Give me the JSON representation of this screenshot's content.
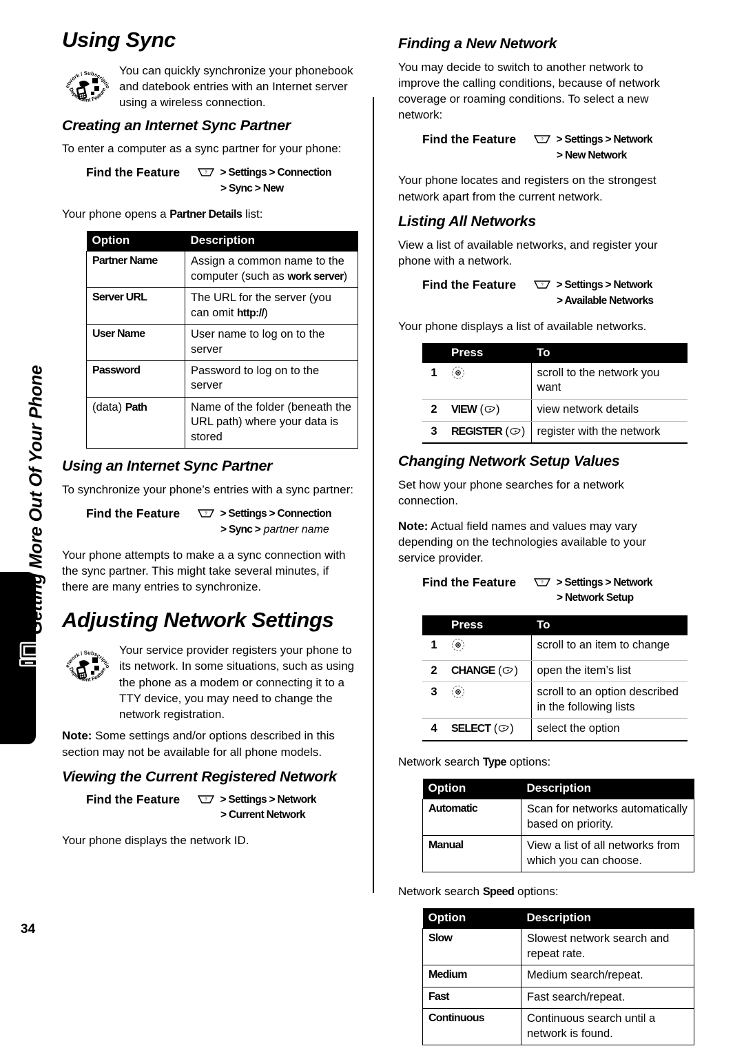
{
  "page": {
    "number": "34",
    "sidebar_title": "Getting More Out Of Your Phone",
    "sidebar_tab_icon": "computer-phone-icon"
  },
  "icons": {
    "menu_key": "menu-key-icon",
    "nav_key": "navigation-key-icon",
    "soft_key": "soft-key-icon",
    "feature_badge_top": "Network / Subscription",
    "feature_badge_bottom": "Dependent Feature"
  },
  "left": {
    "title": "Using Sync",
    "intro": "You can quickly synchronize your phonebook and datebook entries with an Internet server using a wireless connection.",
    "creating": {
      "heading": "Creating an Internet Sync Partner",
      "lead": "To enter a computer as a sync partner for your phone:",
      "fft_label": "Find the Feature",
      "fft_line1": "> Settings > Connection",
      "fft_line2": "> Sync > New",
      "after_pre": "Your phone opens a ",
      "after_bold": "Partner Details",
      "after_post": " list:",
      "table": {
        "headers": [
          "Option",
          "Description"
        ],
        "rows": [
          {
            "option": "Partner Name",
            "desc_pre": "Assign a common name to the computer (such as ",
            "desc_bold": "work server",
            "desc_post": ")"
          },
          {
            "option": "Server URL",
            "desc_pre": "The URL for the server (you can omit ",
            "desc_bold": "http://",
            "desc_post": ")"
          },
          {
            "option": "User Name",
            "desc_pre": "User name to log on to the server",
            "desc_bold": "",
            "desc_post": ""
          },
          {
            "option": "Password",
            "desc_pre": "Password to log on to the server",
            "desc_bold": "",
            "desc_post": ""
          },
          {
            "option_plain": "(data) ",
            "option": "Path",
            "desc_pre": "Name of the folder (beneath the URL path) where your data is stored",
            "desc_bold": "",
            "desc_post": ""
          }
        ]
      }
    },
    "using": {
      "heading": "Using an Internet Sync Partner",
      "lead": "To synchronize your phone’s entries with a sync partner:",
      "fft_label": "Find the Feature",
      "fft_line1": "> Settings > Connection",
      "fft_line2_bold": "> Sync >",
      "fft_line2_italic": "partner name",
      "after": "Your phone attempts to make a a sync connection with the sync partner. This might take several minutes, if there are many entries to synchronize."
    },
    "adjusting": {
      "title": "Adjusting Network Settings",
      "intro": "Your service provider registers your phone to its network. In some situations, such as using the phone as a modem or connecting it to a TTY device, you may need to change the network registration.",
      "note_label": "Note:",
      "note_text": " Some settings and/or options described in this section may not be available for all phone models."
    },
    "viewing": {
      "heading": "Viewing the Current Registered Network",
      "fft_label": "Find the Feature",
      "fft_line1": "> Settings > Network",
      "fft_line2": "> Current Network",
      "after": "Your phone displays the network ID."
    }
  },
  "right": {
    "finding": {
      "heading": "Finding a New Network",
      "lead": "You may decide to switch to another network to improve the calling conditions, because of network coverage or roaming conditions. To select a new network:",
      "fft_label": "Find the Feature",
      "fft_line1": "> Settings > Network",
      "fft_line2": "> New Network",
      "after": "Your phone locates and registers on the strongest network apart from the current network."
    },
    "listing": {
      "heading": "Listing All Networks",
      "lead": "View a list of available networks, and register your phone with a network.",
      "fft_label": "Find the Feature",
      "fft_line1": "> Settings > Network",
      "fft_line2": "> Available Networks",
      "after": "Your phone displays a list of available networks.",
      "table": {
        "headers": [
          "",
          "Press",
          "To"
        ],
        "rows": [
          {
            "num": "1",
            "key": "",
            "key_icon": "nav",
            "to": "scroll to the network you want"
          },
          {
            "num": "2",
            "key": "VIEW",
            "key_icon": "soft",
            "to": "view network details"
          },
          {
            "num": "3",
            "key": "REGISTER",
            "key_icon": "soft",
            "to": "register with the network"
          }
        ]
      }
    },
    "changing": {
      "heading": "Changing Network Setup Values",
      "lead": "Set how your phone searches for a network connection.",
      "note_label": "Note:",
      "note_text": " Actual field names and values may vary depending on the technologies available to your service provider.",
      "fft_label": "Find the Feature",
      "fft_line1": "> Settings > Network",
      "fft_line2": "> Network Setup",
      "table": {
        "headers": [
          "",
          "Press",
          "To"
        ],
        "rows": [
          {
            "num": "1",
            "key": "",
            "key_icon": "nav",
            "to": "scroll to an item to change"
          },
          {
            "num": "2",
            "key": "CHANGE",
            "key_icon": "soft",
            "to": "open the item’s list"
          },
          {
            "num": "3",
            "key": "",
            "key_icon": "nav",
            "to": "scroll to an option described in the following lists"
          },
          {
            "num": "4",
            "key": "SELECT",
            "key_icon": "soft",
            "to": "select the option"
          }
        ]
      },
      "type_lead_pre": "Network search ",
      "type_lead_bold": "Type",
      "type_lead_post": " options:",
      "type_table": {
        "headers": [
          "Option",
          "Description"
        ],
        "rows": [
          {
            "option": "Automatic",
            "desc": "Scan for networks automatically based on priority."
          },
          {
            "option": "Manual",
            "desc": "View a list of all networks from which you can choose."
          }
        ]
      },
      "speed_lead_pre": "Network search ",
      "speed_lead_bold": "Speed",
      "speed_lead_post": " options:",
      "speed_table": {
        "headers": [
          "Option",
          "Description"
        ],
        "rows": [
          {
            "option": "Slow",
            "desc": "Slowest network search and repeat rate."
          },
          {
            "option": "Medium",
            "desc": "Medium search/repeat."
          },
          {
            "option": "Fast",
            "desc": "Fast search/repeat."
          },
          {
            "option": "Continuous",
            "desc": "Continuous search until a network is found."
          }
        ]
      }
    }
  }
}
